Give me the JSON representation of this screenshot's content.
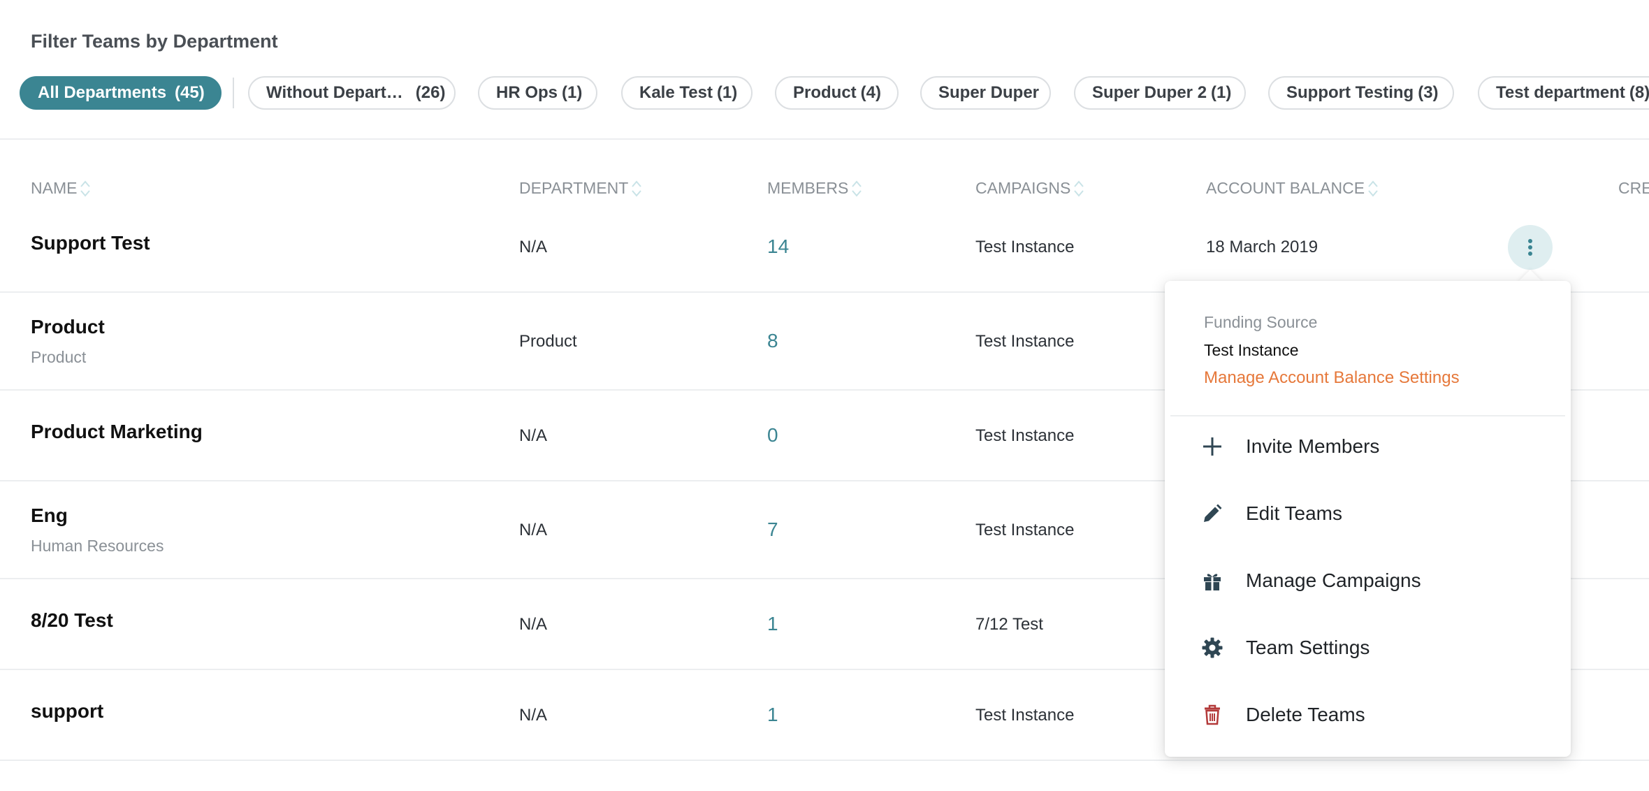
{
  "filter": {
    "title": "Filter Teams by Department",
    "chips": [
      {
        "label": "All Departments",
        "count": "(45)",
        "active": true
      },
      {
        "label": "Without Depart…",
        "count": "(26)"
      },
      {
        "label": "HR Ops",
        "count": "(1)"
      },
      {
        "label": "Kale Test",
        "count": "(1)"
      },
      {
        "label": "Product",
        "count": "(4)"
      },
      {
        "label": "Super Duper",
        "count": ""
      },
      {
        "label": "Super Duper 2",
        "count": "(1)"
      },
      {
        "label": "Support Testing",
        "count": "(3)"
      },
      {
        "label": "Test department",
        "count": "(8)"
      }
    ]
  },
  "table": {
    "columns": [
      "NAME",
      "DEPARTMENT",
      "MEMBERS",
      "CAMPAIGNS",
      "ACCOUNT BALANCE",
      "CRE"
    ],
    "rows": [
      {
        "name": "Support Test",
        "sub": "",
        "department": "N/A",
        "members": "14",
        "campaign": "Test Instance",
        "balance": "18 March 2019"
      },
      {
        "name": "Product",
        "sub": "Product",
        "department": "Product",
        "members": "8",
        "campaign": "Test Instance",
        "balance": ""
      },
      {
        "name": "Product Marketing",
        "sub": "",
        "department": "N/A",
        "members": "0",
        "campaign": "Test Instance",
        "balance": ""
      },
      {
        "name": "Eng",
        "sub": "Human Resources",
        "department": "N/A",
        "members": "7",
        "campaign": "Test Instance",
        "balance": ""
      },
      {
        "name": "8/20 Test",
        "sub": "",
        "department": "N/A",
        "members": "1",
        "campaign": "7/12 Test",
        "balance": ""
      },
      {
        "name": "support",
        "sub": "",
        "department": "N/A",
        "members": "1",
        "campaign": "Test Instance",
        "balance": ""
      }
    ]
  },
  "menu": {
    "funding_label": "Funding Source",
    "funding_value": "Test Instance",
    "manage_link": "Manage Account Balance Settings",
    "items": [
      {
        "label": "Invite Members",
        "icon": "plus-icon"
      },
      {
        "label": "Edit Teams",
        "icon": "pencil-icon"
      },
      {
        "label": "Manage Campaigns",
        "icon": "gift-icon"
      },
      {
        "label": "Team Settings",
        "icon": "gear-icon"
      },
      {
        "label": "Delete Teams",
        "icon": "trash-icon"
      }
    ]
  },
  "colors": {
    "accent": "#3b8592",
    "link": "#e6783a",
    "danger": "#b33a3a",
    "icon": "#2f4653"
  }
}
